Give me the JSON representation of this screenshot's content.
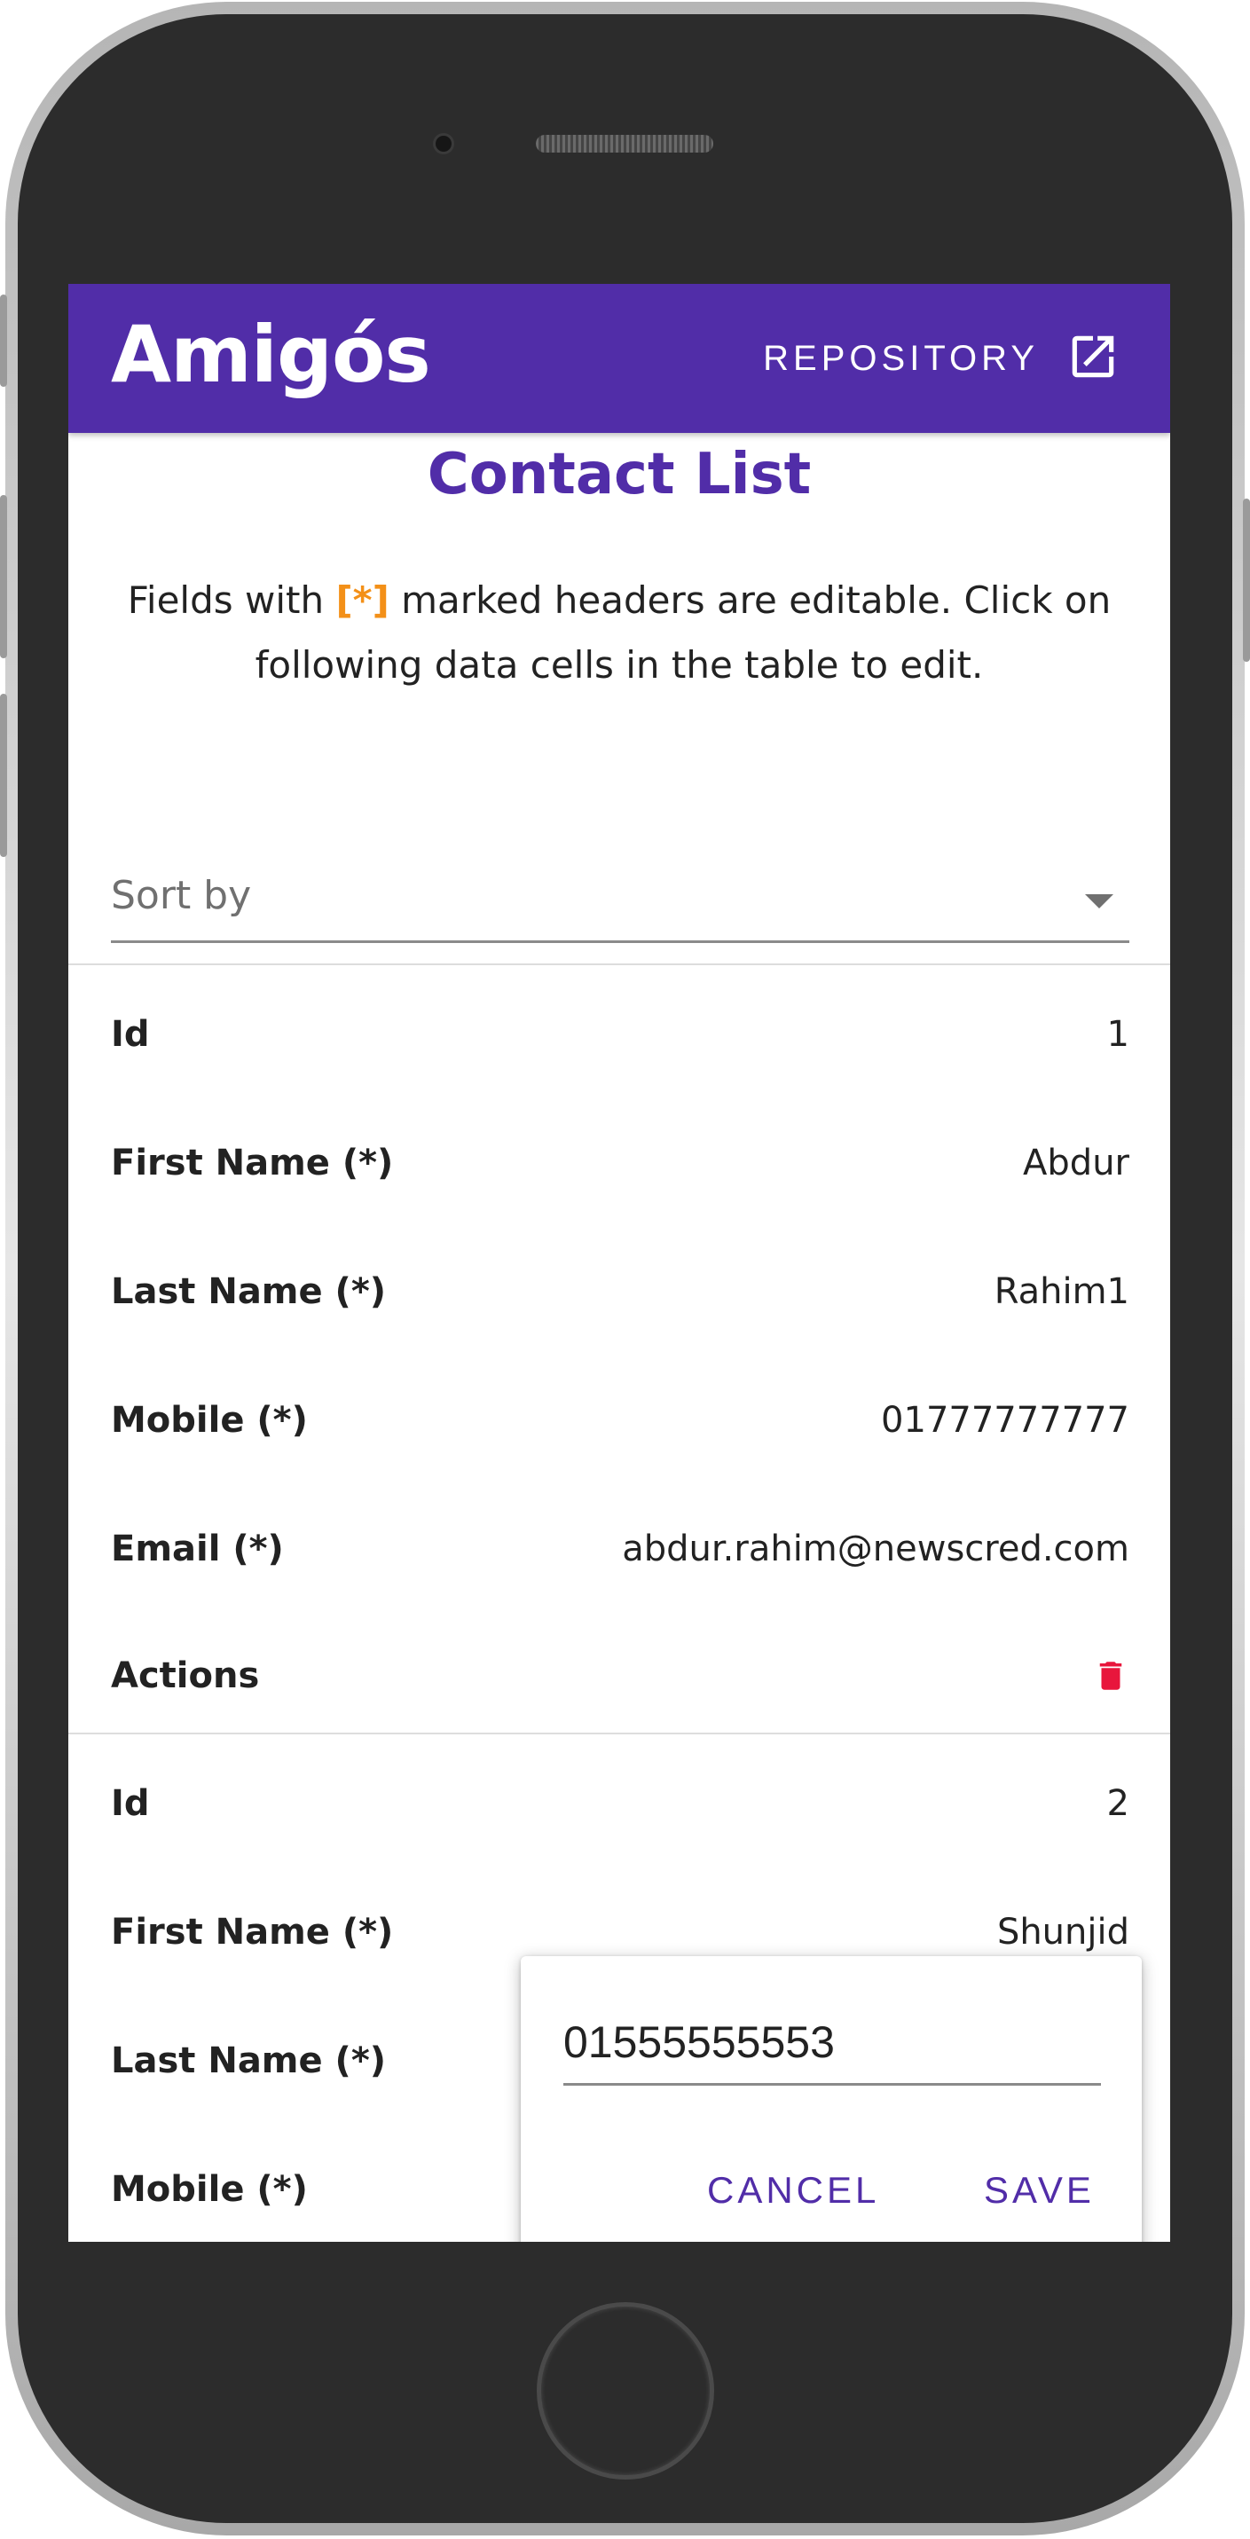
{
  "app": {
    "title": "Amigós",
    "repo_label": "REPOSITORY",
    "repo_icon": "open-in-new-icon"
  },
  "page": {
    "title": "Contact List",
    "intro_before": "Fields with ",
    "intro_mark": "[*]",
    "intro_after": " marked headers are editable. Click on following data cells in the table to edit."
  },
  "sort": {
    "label": "Sort by",
    "icon": "dropdown-arrow-icon"
  },
  "records": [
    {
      "id_label": "Id",
      "id": "1",
      "first_label": "First Name (*)",
      "first": "Abdur",
      "last_label": "Last Name (*)",
      "last": "Rahim1",
      "mobile_label": "Mobile (*)",
      "mobile": "01777777777",
      "email_label": "Email (*)",
      "email": "abdur.rahim@newscred.com",
      "actions_label": "Actions",
      "action_icon": "trash-icon"
    },
    {
      "id_label": "Id",
      "id": "2",
      "first_label": "First Name (*)",
      "first": "Shunjid",
      "last_label": "Last Name (*)",
      "mobile_label": "Mobile (*)"
    }
  ],
  "editor": {
    "value": "01555555553",
    "cancel_label": "CANCEL",
    "save_label": "SAVE"
  },
  "colors": {
    "primary": "#512da8",
    "accent": "#f39018",
    "danger": "#e8163c"
  }
}
